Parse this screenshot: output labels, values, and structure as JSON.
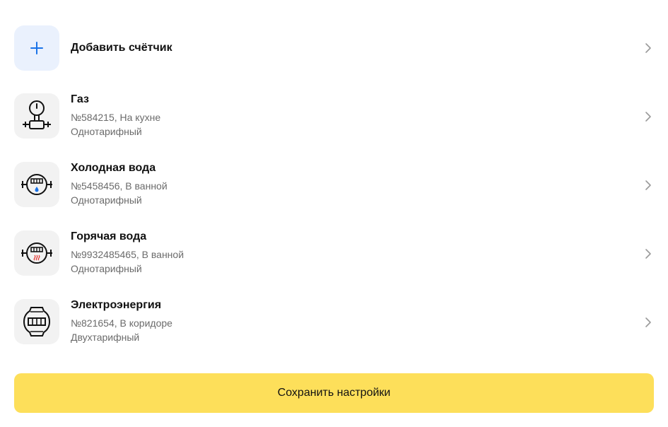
{
  "add_meter": {
    "label": "Добавить счётчик",
    "icon": "plus-icon",
    "accent": "#1a73e8"
  },
  "meters": [
    {
      "title": "Газ",
      "detail": "№584215, На кухне",
      "tariff": "Однотарифный",
      "icon": "gas-meter-icon"
    },
    {
      "title": "Холодная вода",
      "detail": "№5458456, В ванной",
      "tariff": "Однотарифный",
      "icon": "cold-water-meter-icon",
      "icon_accent": "#1a73e8"
    },
    {
      "title": "Горячая вода",
      "detail": "№9932485465, В ванной",
      "tariff": "Однотарифный",
      "icon": "hot-water-meter-icon",
      "icon_accent": "#e53935"
    },
    {
      "title": "Электроэнергия",
      "detail": "№821654, В коридоре",
      "tariff": "Двухтарифный",
      "icon": "electricity-meter-icon"
    }
  ],
  "save_button": {
    "label": "Сохранить настройки",
    "background": "#fddf5a"
  },
  "colors": {
    "tile_bg": "#f2f2f2",
    "add_tile_bg": "#eaf1fd",
    "secondary_text": "#6b6b6b"
  }
}
